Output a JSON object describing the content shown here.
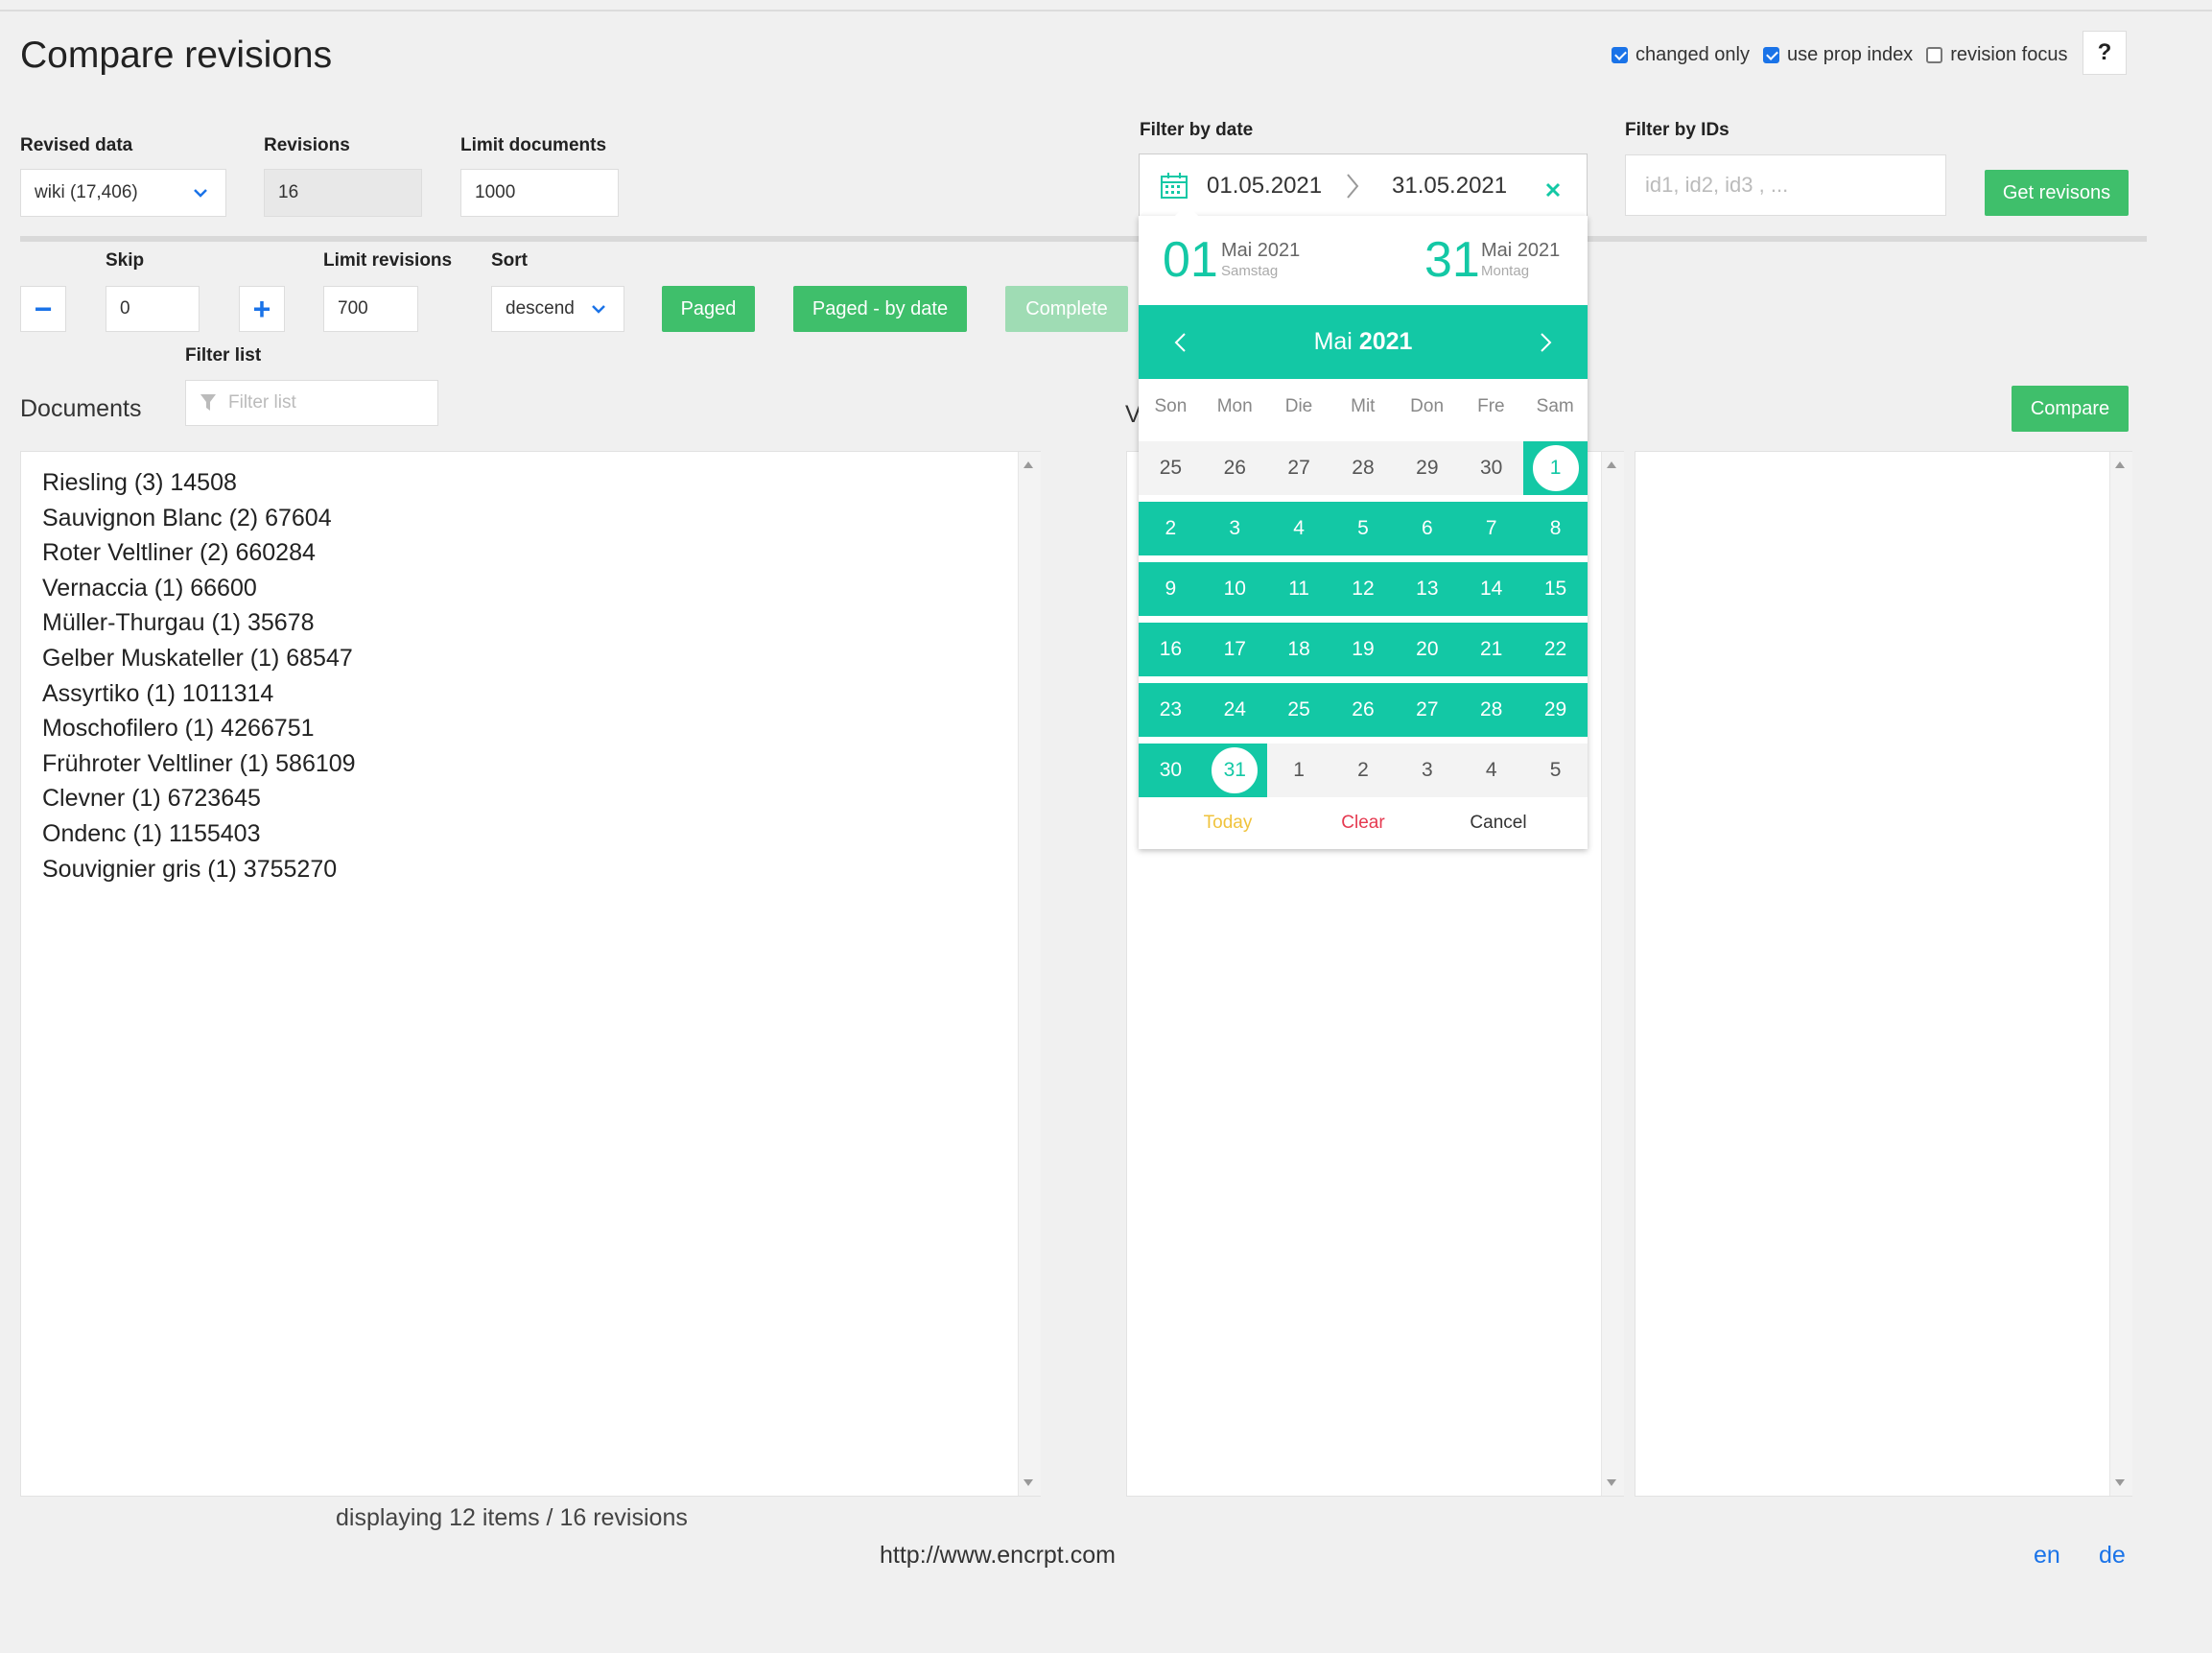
{
  "title": "Compare revisions",
  "options": {
    "changed_only": "changed only",
    "use_prop_index": "use prop index",
    "revision_focus": "revision focus",
    "help": "?"
  },
  "form": {
    "revised_data_label": "Revised data",
    "revised_data_value": "wiki (17,406)",
    "revisions_label": "Revisions",
    "revisions_value": "16",
    "limit_docs_label": "Limit documents",
    "limit_docs_value": "1000",
    "filter_date_label": "Filter by date",
    "date_from": "01.05.2021",
    "date_to": "31.05.2021",
    "filter_ids_label": "Filter by IDs",
    "filter_ids_placeholder": "id1, id2, id3 , ...",
    "get_revisions": "Get revisons"
  },
  "paging": {
    "minus": "−",
    "plus": "+",
    "skip_label": "Skip",
    "skip_value": "0",
    "limit_rev_label": "Limit revisions",
    "limit_rev_value": "700",
    "sort_label": "Sort",
    "sort_value": "descend",
    "paged": "Paged",
    "paged_by_date": "Paged - by date",
    "complete": "Complete",
    "filter_list_label": "Filter list",
    "filter_list_placeholder": "Filter list"
  },
  "documents_label": "Documents",
  "versions_label_partial": "V",
  "compare": "Compare",
  "documents": [
    "Riesling (3) 14508",
    "Sauvignon Blanc (2) 67604",
    "Roter Veltliner (2) 660284",
    "Vernaccia (1) 66600",
    "Müller-Thurgau (1) 35678",
    "Gelber Muskateller (1) 68547",
    "Assyrtiko (1) 1011314",
    "Moschofilero (1) 4266751",
    "Frühroter Veltliner (1) 586109",
    "Clevner (1) 6723645",
    "Ondenc (1) 1155403",
    "Souvignier gris (1) 3755270"
  ],
  "status": "displaying 12 items / 16 revisions",
  "footer_url": "http://www.encrpt.com",
  "lang_en": "en",
  "lang_de": "de",
  "datepicker": {
    "start_day": "01",
    "start_month": "Mai 2021",
    "start_weekday": "Samstag",
    "end_day": "31",
    "end_month": "Mai 2021",
    "end_weekday": "Montag",
    "month_name": "Mai",
    "year": "2021",
    "weekdays": [
      "Son",
      "Mon",
      "Die",
      "Mit",
      "Don",
      "Fre",
      "Sam"
    ],
    "weeks": [
      [
        "25",
        "26",
        "27",
        "28",
        "29",
        "30",
        "1"
      ],
      [
        "2",
        "3",
        "4",
        "5",
        "6",
        "7",
        "8"
      ],
      [
        "9",
        "10",
        "11",
        "12",
        "13",
        "14",
        "15"
      ],
      [
        "16",
        "17",
        "18",
        "19",
        "20",
        "21",
        "22"
      ],
      [
        "23",
        "24",
        "25",
        "26",
        "27",
        "28",
        "29"
      ],
      [
        "30",
        "31",
        "1",
        "2",
        "3",
        "4",
        "5"
      ]
    ],
    "today": "Today",
    "clear": "Clear",
    "cancel": "Cancel"
  },
  "colors": {
    "accent_teal": "#13c8a5",
    "button_green": "#3fbf6b",
    "today_yellow": "#f0c33c",
    "clear_red": "#e53950"
  }
}
